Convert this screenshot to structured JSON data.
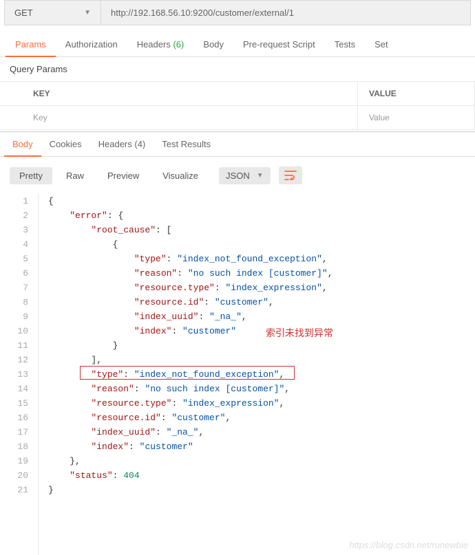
{
  "request": {
    "method": "GET",
    "url": "http://192.168.56.10:9200/customer/external/1"
  },
  "req_tabs": {
    "params": "Params",
    "auth": "Authorization",
    "headers": "Headers",
    "headers_count": "(6)",
    "body": "Body",
    "prereq": "Pre-request Script",
    "tests": "Tests",
    "settings": "Set"
  },
  "query_params": {
    "title": "Query Params",
    "key_header": "KEY",
    "value_header": "VALUE",
    "key_placeholder": "Key",
    "value_placeholder": "Value"
  },
  "resp_tabs": {
    "body": "Body",
    "cookies": "Cookies",
    "headers": "Headers",
    "headers_count": "(4)",
    "tests": "Test Results"
  },
  "toolbar": {
    "pretty": "Pretty",
    "raw": "Raw",
    "preview": "Preview",
    "visualize": "Visualize",
    "format": "JSON"
  },
  "json": {
    "error_key": "\"error\"",
    "root_cause_key": "\"root_cause\"",
    "type_key": "\"type\"",
    "type_val": "\"index_not_found_exception\"",
    "reason_key": "\"reason\"",
    "reason_val": "\"no such index [customer]\"",
    "res_type_key": "\"resource.type\"",
    "res_type_val": "\"index_expression\"",
    "res_id_key": "\"resource.id\"",
    "res_id_val": "\"customer\"",
    "uuid_key": "\"index_uuid\"",
    "uuid_val": "\"_na_\"",
    "index_key": "\"index\"",
    "index_val": "\"customer\"",
    "status_key": "\"status\"",
    "status_val": "404"
  },
  "lines": [
    "1",
    "2",
    "3",
    "4",
    "5",
    "6",
    "7",
    "8",
    "9",
    "10",
    "11",
    "12",
    "13",
    "14",
    "15",
    "16",
    "17",
    "18",
    "19",
    "20",
    "21"
  ],
  "annotation": "索引未找到异常",
  "watermark": "https://blog.csdn.net/runewbie"
}
